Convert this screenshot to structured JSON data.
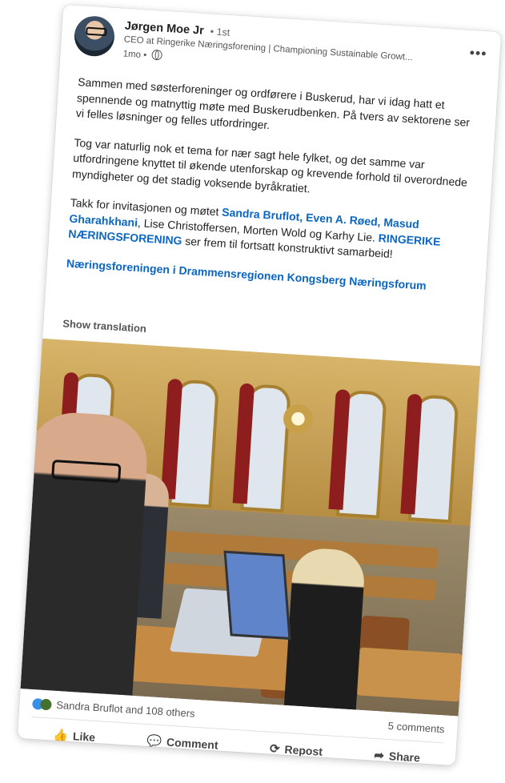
{
  "post": {
    "author": "Jørgen Moe Jr",
    "degree": "• 1st",
    "headline": "CEO at Ringerike Næringsforening | Championing Sustainable Growt...",
    "time": "1mo •",
    "more": "•••",
    "paragraph1": "Sammen med søsterforeninger og ordførere i Buskerud, har vi idag hatt et spennende og matnyttig møte med Buskerudbenken. På tvers av sektorene ser vi felles løsninger og felles utfordringer.",
    "paragraph2": "Tog var naturlig nok et tema for nær sagt hele fylket, og det samme var utfordringene knyttet til økende utenforskap og krevende forhold til overordnede myndigheter og det stadig voksende byråkratiet.",
    "p3_intro": "Takk for invitasjonen og møtet ",
    "p3_mentions1": "Sandra Bruflot, Even A. Røed, Masud Gharahkhani",
    "p3_mid": ", Lise Christoffersen, Morten Wold og Karhy Lie. ",
    "p3_mention2": "RINGERIKE NÆRINGSFORENING",
    "p3_end": " ser frem til fortsatt konstruktivt samarbeid!",
    "tags": "Næringsforeningen i Drammensregionen Kongsberg Næringsforum",
    "show_translation": "Show translation"
  },
  "social": {
    "reactions": "Sandra Bruflot and 108 others",
    "comments": "5 comments"
  },
  "actions": {
    "like": "Like",
    "comment": "Comment",
    "repost": "Repost",
    "share": "Share"
  },
  "colors": {
    "link": "#0a66c2",
    "text": "#222222",
    "muted": "#555555"
  }
}
